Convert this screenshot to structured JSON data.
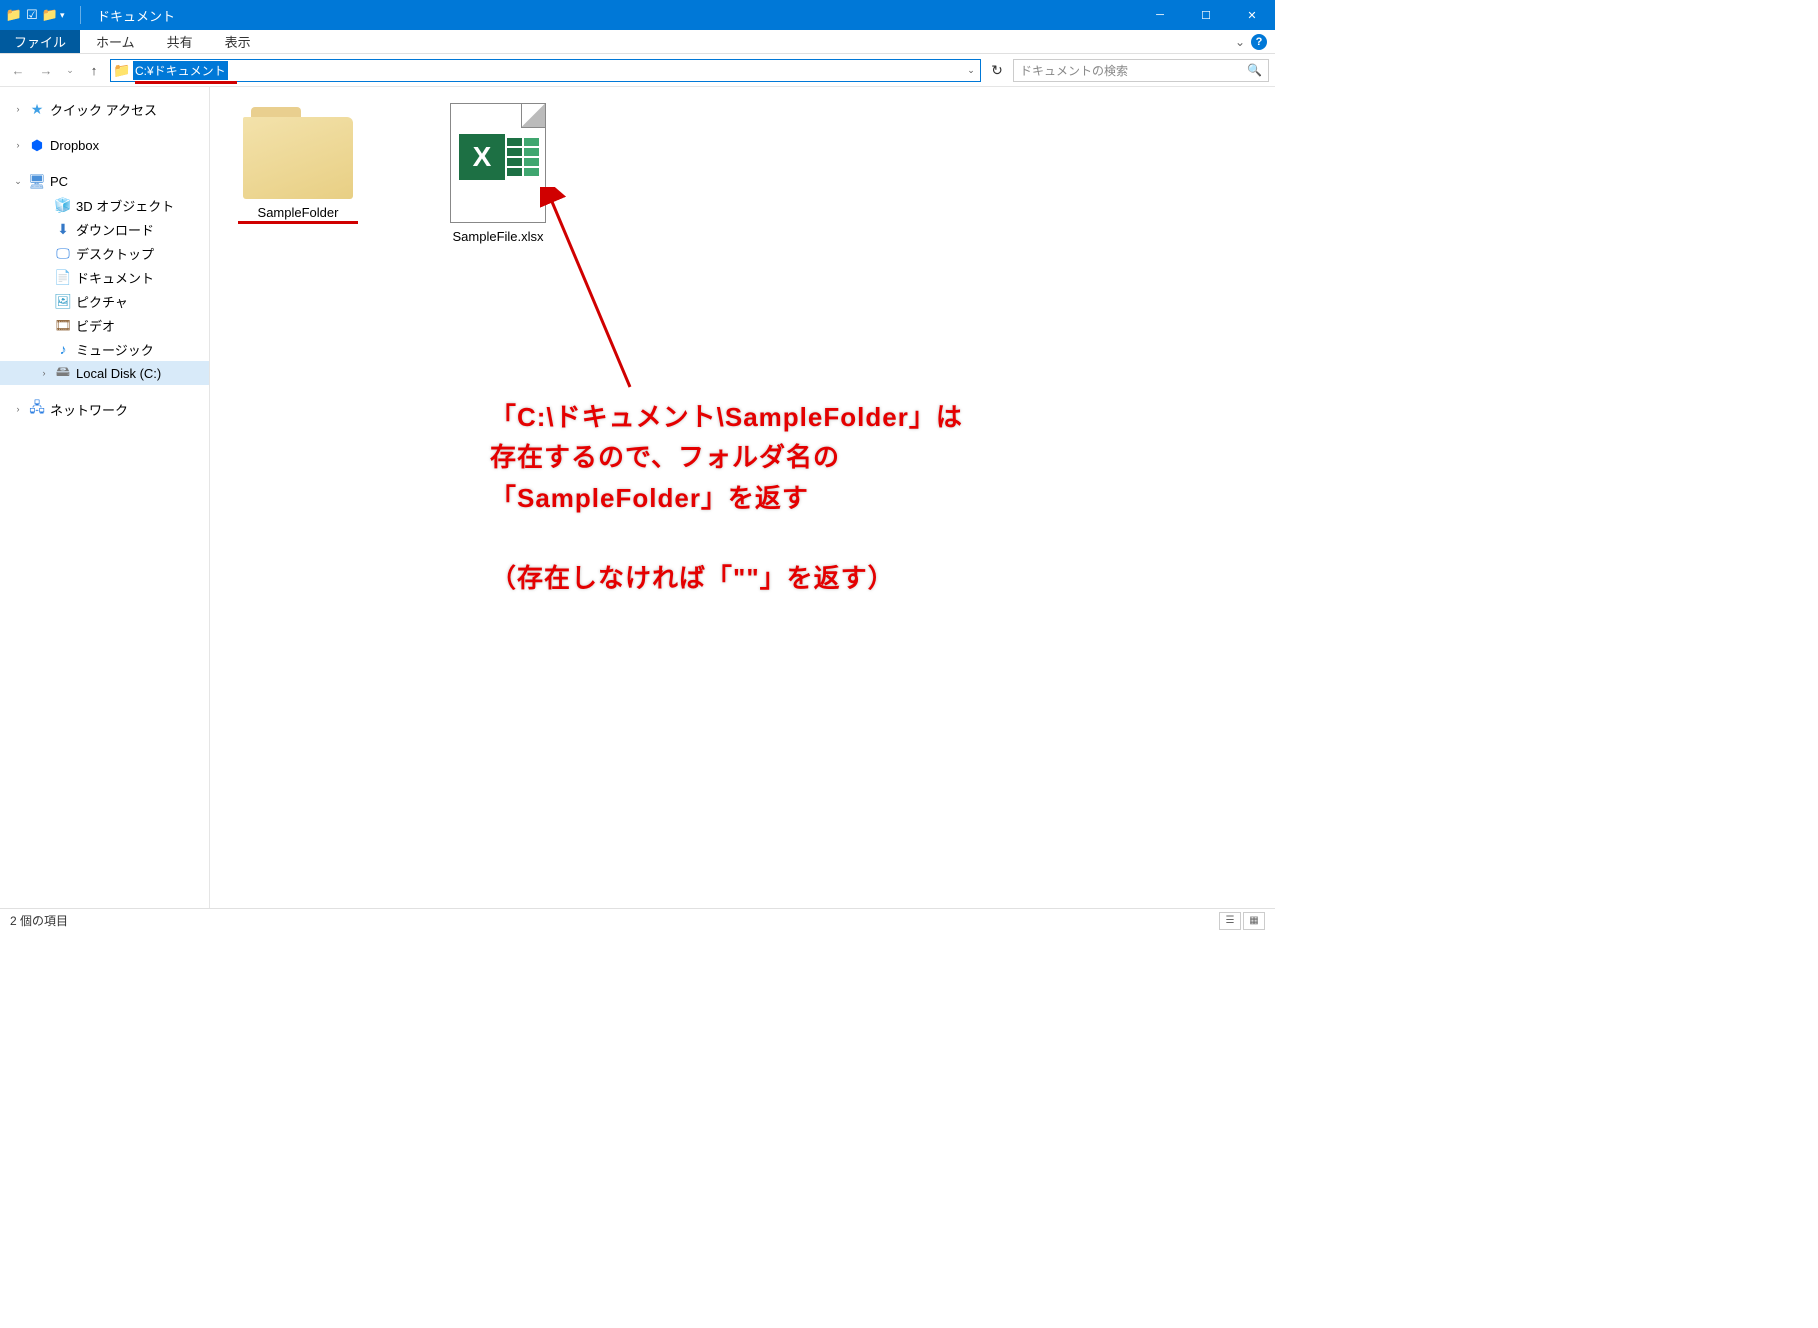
{
  "title": "ドキュメント",
  "ribbon": {
    "file": "ファイル",
    "tabs": [
      "ホーム",
      "共有",
      "表示"
    ]
  },
  "address": {
    "path": "C:¥ドキュメント",
    "search_placeholder": "ドキュメントの検索"
  },
  "nav": {
    "quick_access": "クイック アクセス",
    "dropbox": "Dropbox",
    "pc": "PC",
    "pc_children": [
      "3D オブジェクト",
      "ダウンロード",
      "デスクトップ",
      "ドキュメント",
      "ピクチャ",
      "ビデオ",
      "ミュージック",
      "Local Disk (C:)"
    ],
    "network": "ネットワーク"
  },
  "items": [
    {
      "name": "SampleFolder",
      "type": "folder"
    },
    {
      "name": "SampleFile.xlsx",
      "type": "excel"
    }
  ],
  "annotation": "「C:\\ドキュメント\\SampleFolder」は\n存在するので、フォルダ名の\n「SampleFolder」を返す\n\n（存在しなければ「\"\"」を返す）",
  "status": "2 個の項目"
}
